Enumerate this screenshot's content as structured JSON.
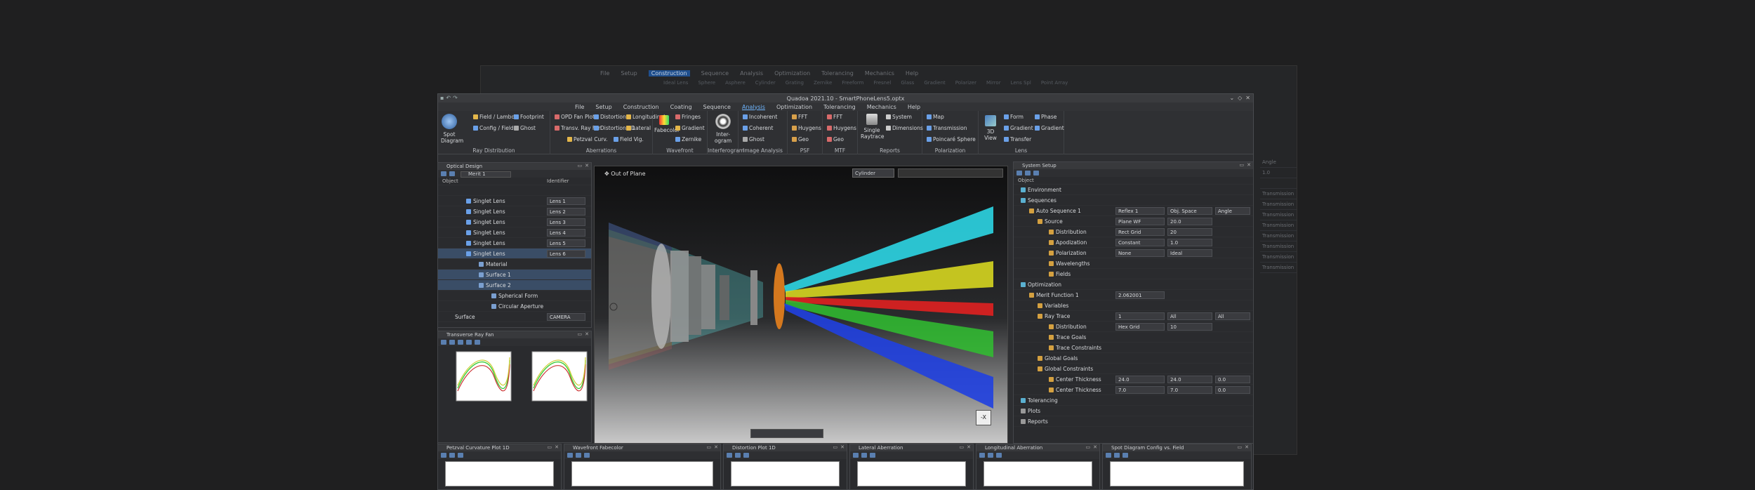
{
  "bg_window": {
    "menu": [
      "File",
      "Setup",
      "Construction",
      "Sequence",
      "Analysis",
      "Optimization",
      "Tolerancing",
      "Mechanics",
      "Help"
    ],
    "selected": "Construction",
    "tools": [
      "Ideal Lens",
      "Sphere",
      "Asphere",
      "Cylinder",
      "Grating",
      "Zernike",
      "Freeform",
      "Fresnel",
      "Glass",
      "Gradient",
      "Polarizer",
      "Mirror",
      "Lens Spl",
      "Point Array"
    ],
    "right_rows": [
      "Angle",
      "1.0",
      "",
      "Transmission",
      "Transmission",
      "Transmission",
      "Transmission",
      "Transmission",
      "Transmission",
      "Transmission",
      "Transmission"
    ]
  },
  "window": {
    "title": "Quadoa 2021.10 - SmartPhoneLens5.optx",
    "controls": [
      "⌄",
      "◇",
      "✕"
    ]
  },
  "menubar": [
    "File",
    "Setup",
    "Construction",
    "Coating",
    "Sequence",
    "Analysis",
    "Optimization",
    "Tolerancing",
    "Mechanics",
    "Help"
  ],
  "menubar_selected": "Analysis",
  "ribbon": {
    "ray_distribution": {
      "label": "Ray Distribution",
      "spot": "Spot Diagram",
      "items": [
        "Field / Lambda",
        "Footprint",
        "Config / Field",
        "Ghost"
      ]
    },
    "aberrations": {
      "label": "Aberrations",
      "items": [
        "OPD Fan Plot",
        "Distortion",
        "Longitudinal",
        "Transv. Ray Fan",
        "Distortion 2D",
        "Lateral",
        "Petzval Curv.",
        "Field Vig."
      ]
    },
    "wavefront": {
      "label": "Wavefront",
      "fabecolor": "Fabecolor",
      "items": [
        "Fringes",
        "Gradient",
        "Zernike"
      ]
    },
    "interferogram": {
      "label": "Interferogram",
      "big": "Inter- ogram"
    },
    "image_analysis": {
      "label": "Image Analysis",
      "items": [
        "Incoherent",
        "Coherent",
        "Ghost"
      ]
    },
    "psf": {
      "label": "PSF",
      "items": [
        "FFT",
        "Huygens",
        "Geo"
      ]
    },
    "mtf": {
      "label": "MTF",
      "items": [
        "FFT",
        "Huygens",
        "Geo"
      ]
    },
    "reports": {
      "label": "Reports",
      "single": "Single Raytrace",
      "items": [
        "System",
        "Dimensions"
      ]
    },
    "polarization": {
      "label": "Polarization",
      "items": [
        "Map",
        "Transmission",
        "Poincaré Sphere"
      ]
    },
    "lens": {
      "label": "Lens",
      "view": "3D View",
      "items": [
        "Form",
        "Phase",
        "Gradient",
        "Gradient",
        "Transfer"
      ]
    }
  },
  "optical_design": {
    "title": "Optical Design",
    "dropdown": "Merit 1",
    "col_object": "Object",
    "col_identifier": "Identifier",
    "rows": [
      {
        "name": "Singlet Lens",
        "id": "Lens 1"
      },
      {
        "name": "Singlet Lens",
        "id": "Lens 2"
      },
      {
        "name": "Singlet Lens",
        "id": "Lens 3"
      },
      {
        "name": "Singlet Lens",
        "id": "Lens 4"
      },
      {
        "name": "Singlet Lens",
        "id": "Lens 5"
      },
      {
        "name": "Singlet Lens",
        "id": "Lens 6"
      }
    ],
    "children": [
      "Material",
      "Surface 1",
      "Surface 2",
      "Spherical Form",
      "Circular Aperture"
    ],
    "bottom": {
      "name": "Surface",
      "id": "CAMERA"
    }
  },
  "transverse": {
    "title": "Transverse Ray Fan"
  },
  "viewport": {
    "label": "Out of Plane",
    "combo": "Cylinder",
    "axis": "-X"
  },
  "system_setup": {
    "title": "System Setup",
    "col": "Object",
    "rows": [
      {
        "t": "Environment"
      },
      {
        "t": "Sequences"
      },
      {
        "t": "Auto Sequence 1",
        "v1": "Reflex 1",
        "v2": "Obj. Space",
        "v3": "Angle"
      },
      {
        "t": "Source",
        "v1": "Plane WF",
        "v2": "20.0"
      },
      {
        "t": "Distribution",
        "v1": "Rect Grid",
        "v2": "20"
      },
      {
        "t": "Apodization",
        "v1": "Constant",
        "v2": "1.0"
      },
      {
        "t": "Polarization",
        "v1": "None",
        "v2": "Ideal"
      },
      {
        "t": "Wavelengths"
      },
      {
        "t": "Fields"
      },
      {
        "t": "Optimization"
      },
      {
        "t": "Merit Function 1",
        "v1": "2.062001"
      },
      {
        "t": "Variables"
      },
      {
        "t": "Ray Trace",
        "v1": "1",
        "v2": "All",
        "v3": "All"
      },
      {
        "t": "Distribution",
        "v1": "Hex Grid",
        "v2": "10"
      },
      {
        "t": "Trace Goals"
      },
      {
        "t": "Trace Constraints"
      },
      {
        "t": "Global Goals"
      },
      {
        "t": "Global Constraints"
      },
      {
        "t": "Center Thickness",
        "v1": "24.0",
        "v2": "24.0",
        "v3": "0.0"
      },
      {
        "t": "Center Thickness",
        "v1": "7.0",
        "v2": "7.0",
        "v3": "0.0"
      },
      {
        "t": "Tolerancing"
      },
      {
        "t": "Plots"
      },
      {
        "t": "Reports"
      }
    ]
  },
  "bottom_panels": [
    "Petzval Curvature Plot 1D",
    "Wavefront Fabecolor",
    "Distortion Plot 1D",
    "Lateral Aberration",
    "Longitudinal Aberration",
    "Spot Diagram Config vs. Field"
  ],
  "colors": {
    "accent": "#6fb6ff",
    "selection": "#3a4d66"
  }
}
